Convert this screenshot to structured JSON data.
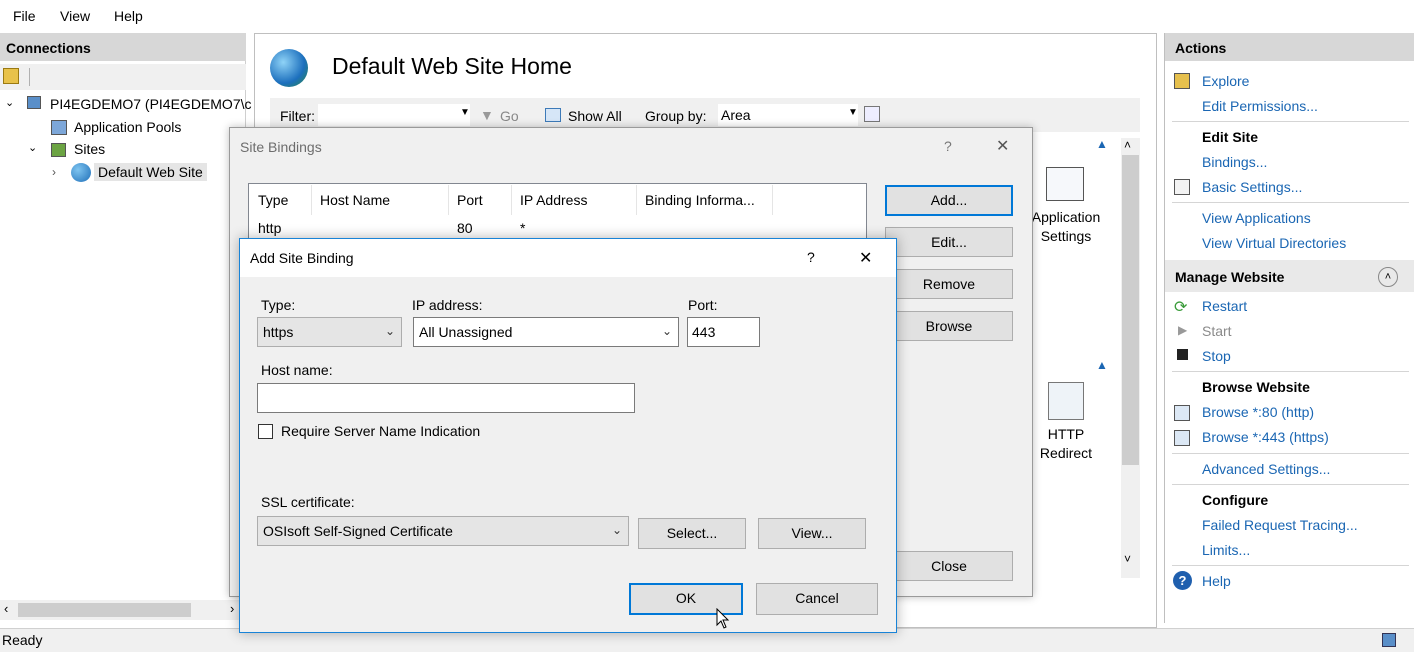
{
  "menu": [
    "File",
    "View",
    "Help"
  ],
  "connections": {
    "title": "Connections",
    "server": "PI4EGDEMO7 (PI4EGDEMO7\\c",
    "app_pools": "Application Pools",
    "sites": "Sites",
    "site": "Default Web Site"
  },
  "center": {
    "title": "Default Web Site Home",
    "filter_label": "Filter:",
    "go": "Go",
    "show_all": "Show All",
    "group_by_label": "Group by:",
    "group_by_value": "Area",
    "feature1": [
      "Application",
      "Settings"
    ],
    "feature2": [
      "HTTP",
      "Redirect"
    ]
  },
  "actions": {
    "title": "Actions",
    "explore": "Explore",
    "edit_permissions": "Edit Permissions...",
    "edit_site": "Edit Site",
    "bindings": "Bindings...",
    "basic_settings": "Basic Settings...",
    "view_applications": "View Applications",
    "view_vdirs": "View Virtual Directories",
    "manage_website": "Manage Website",
    "restart": "Restart",
    "start": "Start",
    "stop": "Stop",
    "browse_website": "Browse Website",
    "browse80": "Browse *:80 (http)",
    "browse443": "Browse *:443 (https)",
    "advanced_settings": "Advanced Settings...",
    "configure": "Configure",
    "failed_tracing": "Failed Request Tracing...",
    "limits": "Limits...",
    "help": "Help"
  },
  "status": {
    "text": "Ready"
  },
  "site_bindings": {
    "title": "Site Bindings",
    "help": "?",
    "close_x": "✕",
    "columns": [
      "Type",
      "Host Name",
      "Port",
      "IP Address",
      "Binding Informa..."
    ],
    "rows": [
      [
        "http",
        "",
        "80",
        "*",
        ""
      ]
    ],
    "add": "Add...",
    "edit": "Edit...",
    "remove": "Remove",
    "browse": "Browse",
    "close": "Close"
  },
  "add_binding": {
    "title": "Add Site Binding",
    "help": "?",
    "close_x": "✕",
    "type_label": "Type:",
    "type_value": "https",
    "ip_label": "IP address:",
    "ip_value": "All Unassigned",
    "port_label": "Port:",
    "port_value": "443",
    "host_label": "Host name:",
    "host_value": "",
    "sni_label": "Require Server Name Indication",
    "ssl_label": "SSL certificate:",
    "ssl_value": "OSIsoft Self-Signed Certificate",
    "select": "Select...",
    "view": "View...",
    "ok": "OK",
    "cancel": "Cancel"
  },
  "colors": {
    "link": "#1a66b3",
    "focus": "#0078d7",
    "header": "#d7d7d7"
  }
}
